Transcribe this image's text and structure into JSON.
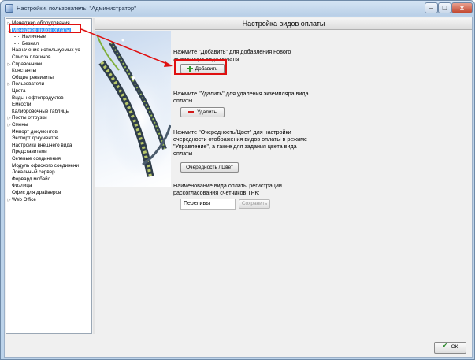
{
  "window": {
    "title": "Настройки. пользователь: \"Администратор\"",
    "controls": {
      "minimize": "–",
      "maximize": "□",
      "close": "x"
    }
  },
  "tree": {
    "items": [
      {
        "label": "Менеджер оборудования",
        "expander": "▷",
        "level": 0
      },
      {
        "label": "Менеджер видов оплаты",
        "expander": "◢",
        "level": 0,
        "selected": true
      },
      {
        "label": "Наличные",
        "expander": "",
        "level": 1
      },
      {
        "label": "Безнал",
        "expander": "",
        "level": 1
      },
      {
        "label": "Назначение используемых ус",
        "expander": "",
        "level": 0
      },
      {
        "label": "Список плагинов",
        "expander": "",
        "level": 0
      },
      {
        "label": "Справочники",
        "expander": "▷",
        "level": 0
      },
      {
        "label": "Константы",
        "expander": "",
        "level": 0
      },
      {
        "label": "Общие реквизиты",
        "expander": "",
        "level": 0
      },
      {
        "label": "Пользователи",
        "expander": "▷",
        "level": 0
      },
      {
        "label": "Цвета",
        "expander": "",
        "level": 0
      },
      {
        "label": "Виды нефтепродуктов",
        "expander": "",
        "level": 0
      },
      {
        "label": "Емкости",
        "expander": "",
        "level": 0
      },
      {
        "label": "Калибровочные таблицы",
        "expander": "",
        "level": 0
      },
      {
        "label": "Посты отгрузки",
        "expander": "▷",
        "level": 0
      },
      {
        "label": "Смены",
        "expander": "▷",
        "level": 0
      },
      {
        "label": "Импорт документов",
        "expander": "",
        "level": 0
      },
      {
        "label": "Экспорт документов",
        "expander": "",
        "level": 0
      },
      {
        "label": "Настройки внешнего вида",
        "expander": "",
        "level": 0
      },
      {
        "label": "Представители",
        "expander": "",
        "level": 0
      },
      {
        "label": "Сетевые соединения",
        "expander": "",
        "level": 0
      },
      {
        "label": "Модуль офисного соединени",
        "expander": "",
        "level": 0
      },
      {
        "label": "Локальный сервер",
        "expander": "",
        "level": 0
      },
      {
        "label": "Форвард мобайл",
        "expander": "",
        "level": 0
      },
      {
        "label": "Физлица",
        "expander": "",
        "level": 0
      },
      {
        "label": "Офис для драйверов",
        "expander": "",
        "level": 0
      },
      {
        "label": "Web Office",
        "expander": "▷",
        "level": 0
      }
    ]
  },
  "panel": {
    "title": "Настройка видов оплаты",
    "add_text": "Нажмите \"Добавить\" для добавления нового экземпляра вида оплаты",
    "add_button": "Добавить",
    "delete_text": "Нажмите \"Удалить\" для удаления экземпляра вида оплаты",
    "delete_button": "Удалить",
    "order_text": "Нажмите \"Очередность/Цвет\" для настройки очередности отображения видов оплаты в режиме \"Управление\", а также для задания цвета вида оплаты",
    "order_button": "Очередность / Цвет",
    "trk_text": "Наименование вида оплаты регистрации рассогласования счетчиков ТРК:",
    "trk_value": "Переливы",
    "save_button": "Сохранить"
  },
  "footer": {
    "ok_button": "ОК"
  },
  "colors": {
    "annotation": "#e01010",
    "selection": "#3399ff",
    "add_icon": "#2e9a2e",
    "delete_icon": "#d21a1a"
  },
  "icons": {
    "add": "plus-icon",
    "delete": "minus-icon",
    "ok": "checkmark-icon"
  }
}
